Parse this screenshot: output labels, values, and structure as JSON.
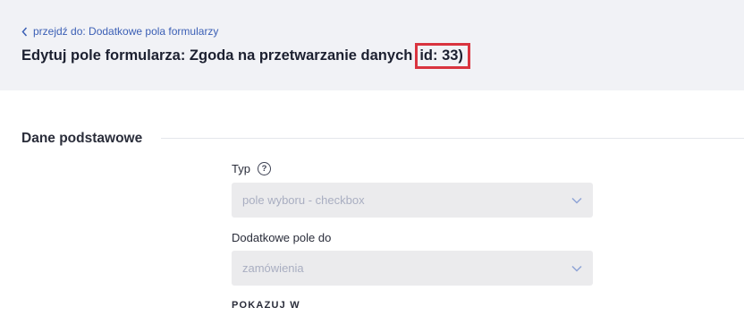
{
  "header": {
    "back_link": "przejdź do: Dodatkowe pola formularzy",
    "title_main": "Edytuj pole formularza: Zgoda na przetwarzanie danych",
    "title_id": "id: 33)"
  },
  "section": {
    "title": "Dane podstawowe"
  },
  "fields": {
    "type": {
      "label": "Typ",
      "value": "pole wyboru - checkbox"
    },
    "extra_field_for": {
      "label": "Dodatkowe pole do",
      "value": "zamówienia"
    },
    "show_in": {
      "label": "POKAZUJ W"
    }
  },
  "colors": {
    "header_bg": "#f1f2f6",
    "link": "#3b5fb5",
    "highlight_border": "#d9343f",
    "select_bg": "#ebebed",
    "select_text": "#a9aec1",
    "chevron": "#8fa4d6"
  },
  "icons": {
    "back": "chevron-left-icon",
    "help": "question-circle-icon",
    "select_arrow": "chevron-down-icon"
  }
}
